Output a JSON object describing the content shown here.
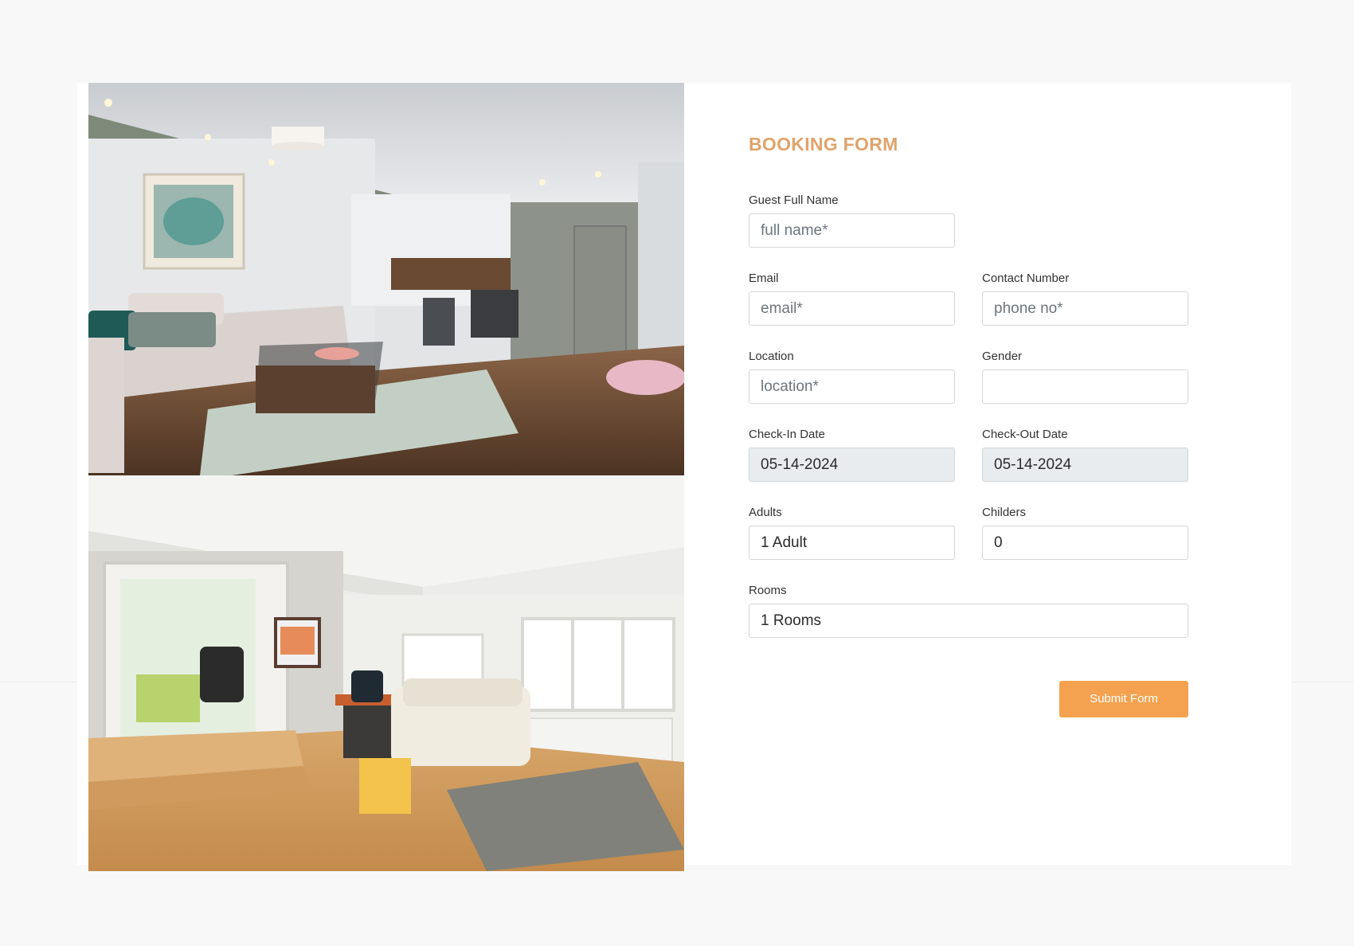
{
  "form": {
    "title": "BOOKING FORM",
    "guest_name": {
      "label": "Guest Full Name",
      "placeholder": "full name*"
    },
    "email": {
      "label": "Email",
      "placeholder": "email*"
    },
    "contact": {
      "label": "Contact Number",
      "placeholder": "phone no*"
    },
    "location": {
      "label": "Location",
      "placeholder": "location*"
    },
    "gender": {
      "label": "Gender",
      "value": ""
    },
    "check_in": {
      "label": "Check-In Date",
      "value": "05-14-2024"
    },
    "check_out": {
      "label": "Check-Out Date",
      "value": "05-14-2024"
    },
    "adults": {
      "label": "Adults",
      "value": "1 Adult"
    },
    "children": {
      "label": "Childers",
      "value": "0"
    },
    "rooms": {
      "label": "Rooms",
      "value": "1 Rooms"
    },
    "submit_label": "Submit Form"
  },
  "colors": {
    "title": "#e0a36b",
    "submit_button": "#f4a24f",
    "readonly_field": "#e9ecef"
  }
}
